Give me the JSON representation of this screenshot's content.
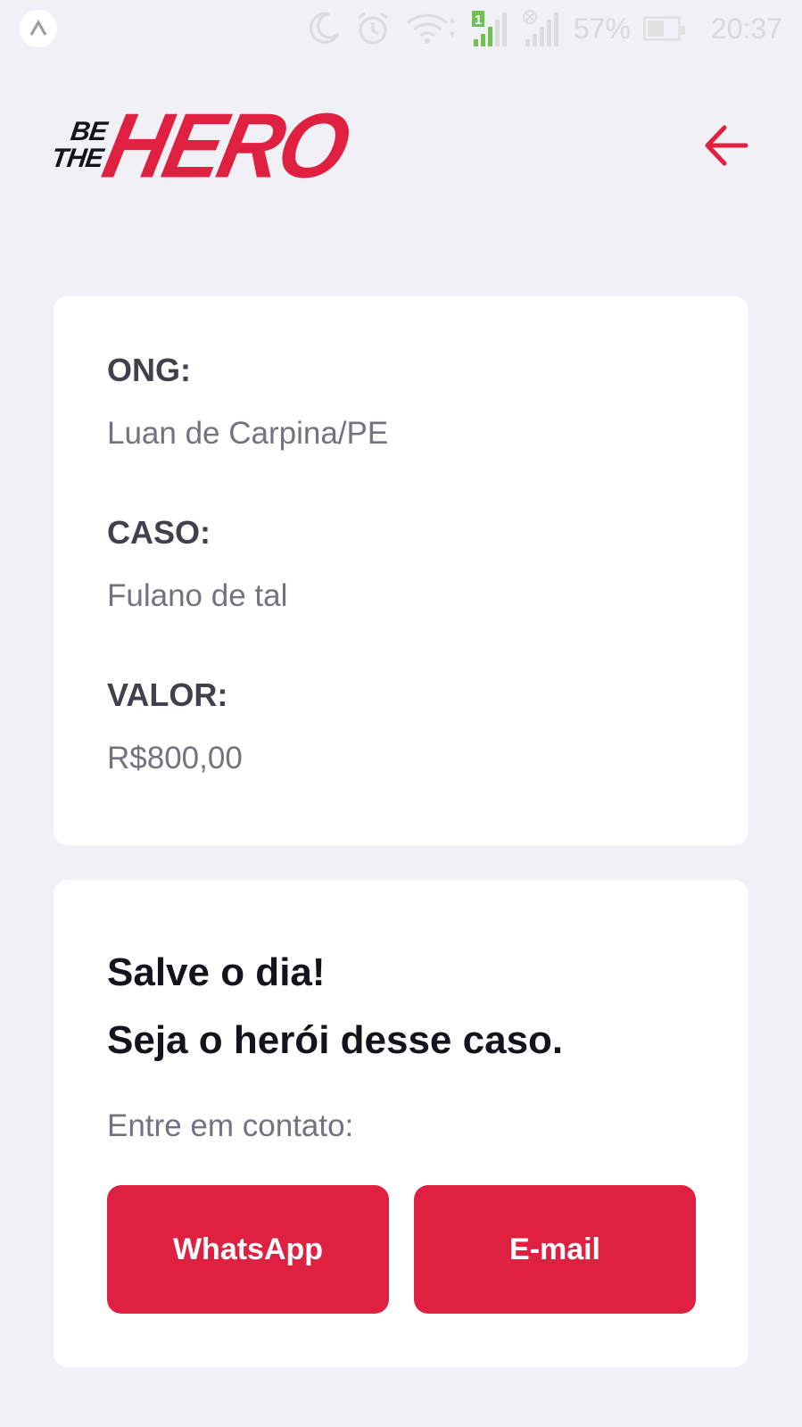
{
  "status_bar": {
    "battery": "57%",
    "time": "20:37",
    "sim_slot": "1"
  },
  "logo": {
    "line1": "BE",
    "line2": "THE",
    "word": "HERO"
  },
  "colors": {
    "accent": "#e02041",
    "background": "#f0f0f5",
    "label": "#41414d",
    "value": "#737380",
    "title": "#13131a"
  },
  "incident": {
    "ong_label": "ONG:",
    "ong_value": "Luan de Carpina/PE",
    "caso_label": "CASO:",
    "caso_value": "Fulano de tal",
    "valor_label": "VALOR:",
    "valor_value": "R$800,00"
  },
  "contact": {
    "title_line1": "Salve o dia!",
    "title_line2": "Seja o herói desse caso.",
    "prompt": "Entre em contato:",
    "whatsapp_label": "WhatsApp",
    "email_label": "E-mail"
  },
  "icons": {
    "back": "arrow-left-icon",
    "moon": "do-not-disturb-moon-icon",
    "alarm": "alarm-icon",
    "wifi": "wifi-icon",
    "signal": "cell-signal-icon"
  }
}
